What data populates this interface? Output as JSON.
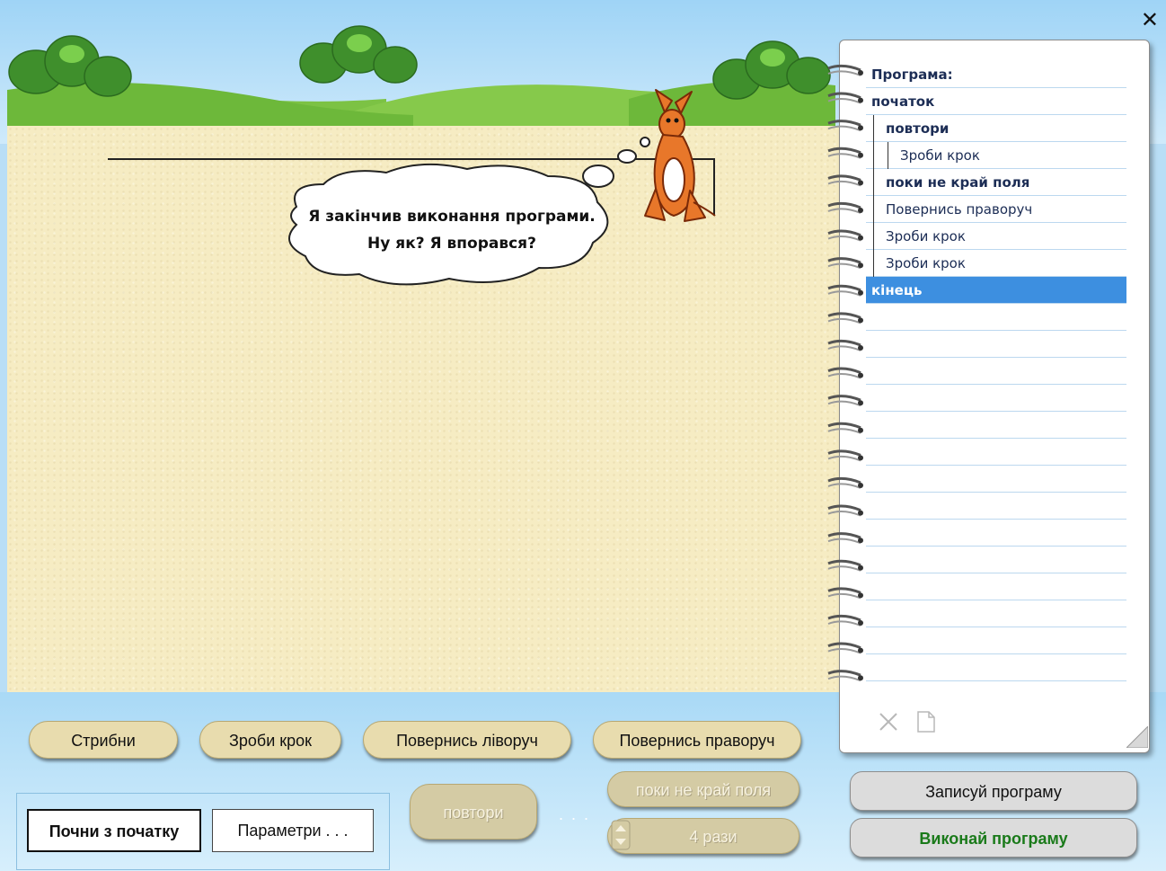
{
  "window": {
    "close_glyph": "✕"
  },
  "scene": {
    "speech": [
      "Я закінчив виконання програми.",
      "Ну як? Я впорався?"
    ],
    "character": "kangaroo"
  },
  "program": {
    "lines": [
      {
        "text": "Програма:",
        "bold": true,
        "indent": 0
      },
      {
        "text": "початок",
        "bold": true,
        "indent": 0
      },
      {
        "text": "повтори",
        "bold": true,
        "indent": 1
      },
      {
        "text": "Зроби крок",
        "bold": false,
        "indent": 2
      },
      {
        "text": "поки не край поля",
        "bold": true,
        "indent": 1
      },
      {
        "text": "Повернись праворуч",
        "bold": false,
        "indent": 1
      },
      {
        "text": "Зроби крок",
        "bold": false,
        "indent": 1
      },
      {
        "text": "Зроби крок",
        "bold": false,
        "indent": 1
      },
      {
        "text": "кінець",
        "bold": true,
        "indent": 0,
        "selected": true
      }
    ],
    "empty_lines": 14,
    "tools": [
      "cut-icon",
      "new-page-icon"
    ]
  },
  "commands": {
    "jump": "Стрибни",
    "step": "Зроби крок",
    "turn_left": "Повернись ліворуч",
    "turn_right": "Повернись праворуч",
    "repeat": "повтори",
    "while_not_edge": "поки не край поля",
    "times": "4 рази",
    "dots": ". . ."
  },
  "actions": {
    "restart": "Почни з початку",
    "params": "Параметри . . .",
    "record": "Записуй програму",
    "run": "Виконай програму"
  },
  "colors": {
    "selection": "#3d8fe0",
    "run_text": "#1a7a1a",
    "sand": "#f6ecc3",
    "sky": "#9fd4f6"
  }
}
